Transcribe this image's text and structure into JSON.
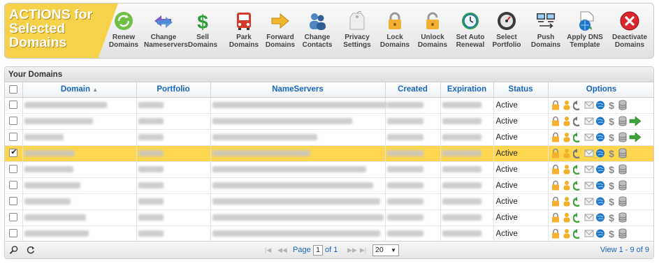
{
  "toolbar": {
    "title": "ACTIONS for Selected Domains",
    "buttons": [
      {
        "label": "Renew\nDomains",
        "icon": "renew-icon"
      },
      {
        "label": "Change\nNameservers",
        "icon": "change-nameservers-icon"
      },
      {
        "label": "Sell\nDomains",
        "icon": "dollar-icon"
      },
      {
        "label": "Park\nDomains",
        "icon": "park-car-icon"
      },
      {
        "label": "Forward\nDomains",
        "icon": "forward-arrow-icon"
      },
      {
        "label": "Change\nContacts",
        "icon": "contacts-icon"
      },
      {
        "label": "Privacy\nSettings",
        "icon": "privacy-tag-icon"
      },
      {
        "label": "Lock\nDomains",
        "icon": "lock-icon"
      },
      {
        "label": "Unlock\nDomains",
        "icon": "unlock-icon"
      },
      {
        "label": "Set Auto\nRenewal",
        "icon": "auto-renew-clock-icon"
      },
      {
        "label": "Select\nPortfolio",
        "icon": "portfolio-gauge-icon"
      },
      {
        "label": "Push\nDomains",
        "icon": "push-computers-icon"
      },
      {
        "label": "Apply DNS\nTemplate",
        "icon": "dns-template-icon"
      },
      {
        "label": "Deactivate\nDomains",
        "icon": "deactivate-x-icon"
      }
    ]
  },
  "grid": {
    "caption": "Your Domains",
    "columns": [
      "Domain",
      "Portfolio",
      "NameServers",
      "Created",
      "Expiration",
      "Status",
      "Options"
    ],
    "sort_indicator": "sort-icon",
    "rows": [
      {
        "checked": false,
        "status": "Active",
        "forward": false,
        "arrow_color": "#777777"
      },
      {
        "checked": false,
        "status": "Active",
        "forward": true,
        "arrow_color": "#777777"
      },
      {
        "checked": false,
        "status": "Active",
        "forward": true,
        "arrow_color": "#3da33a"
      },
      {
        "checked": true,
        "status": "Active",
        "forward": false,
        "arrow_color": "#777777"
      },
      {
        "checked": false,
        "status": "Active",
        "forward": false,
        "arrow_color": "#3da33a"
      },
      {
        "checked": false,
        "status": "Active",
        "forward": false,
        "arrow_color": "#3da33a"
      },
      {
        "checked": false,
        "status": "Active",
        "forward": false,
        "arrow_color": "#3da33a"
      },
      {
        "checked": false,
        "status": "Active",
        "forward": false,
        "arrow_color": "#3da33a"
      },
      {
        "checked": false,
        "status": "Active",
        "forward": false,
        "arrow_color": "#3da33a"
      }
    ]
  },
  "pager": {
    "page_label": "Page",
    "page_value": "1",
    "of_label": "of 1",
    "rows_per_page": "20",
    "view_label": "View 1 - 9 of 9"
  },
  "colors": {
    "accent": "#1565c0",
    "selected_row": "#ffd64f",
    "title_banner": "#f6d24a"
  }
}
